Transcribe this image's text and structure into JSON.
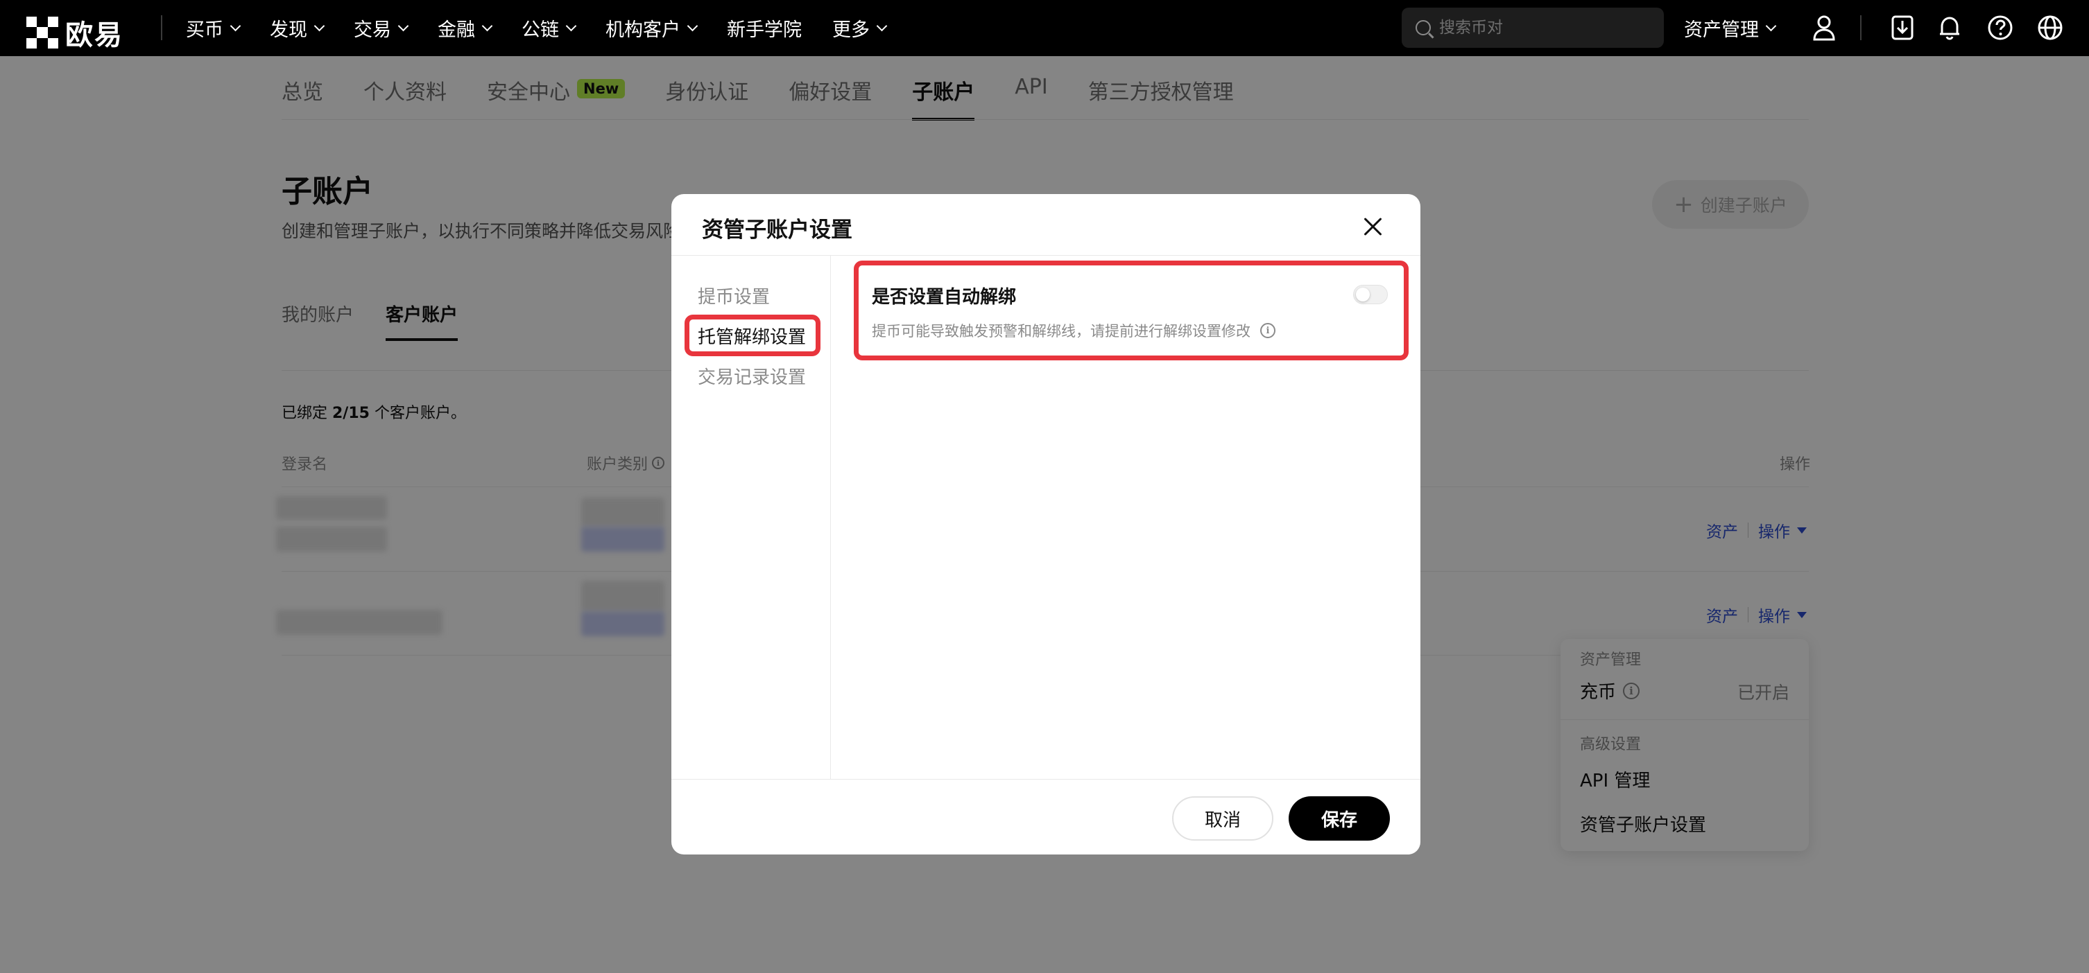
{
  "brand": {
    "name": "欧易"
  },
  "topnav": {
    "items": [
      {
        "label": "买币",
        "dropdown": true
      },
      {
        "label": "发现",
        "dropdown": true
      },
      {
        "label": "交易",
        "dropdown": true
      },
      {
        "label": "金融",
        "dropdown": true
      },
      {
        "label": "公链",
        "dropdown": true
      },
      {
        "label": "机构客户",
        "dropdown": true
      },
      {
        "label": "新手学院",
        "dropdown": false
      },
      {
        "label": "更多",
        "dropdown": true
      }
    ],
    "search_placeholder": "搜索币对",
    "asset_management": "资产管理",
    "icons": [
      "user-icon",
      "download-icon",
      "bell-icon",
      "help-icon",
      "globe-icon"
    ]
  },
  "subnav": {
    "items": [
      {
        "label": "总览"
      },
      {
        "label": "个人资料"
      },
      {
        "label": "安全中心",
        "badge": "New"
      },
      {
        "label": "身份认证"
      },
      {
        "label": "偏好设置"
      },
      {
        "label": "子账户",
        "active": true
      },
      {
        "label": "API"
      },
      {
        "label": "第三方授权管理"
      }
    ]
  },
  "page": {
    "title": "子账户",
    "description": "创建和管理子账户，以执行不同策略并降低交易风险",
    "create_button": "创建子账户",
    "tabs": [
      {
        "label": "我的账户"
      },
      {
        "label": "客户账户",
        "active": true
      }
    ],
    "bound_prefix": "已绑定 ",
    "bound_count": "2/15",
    "bound_suffix": " 个客户账户。",
    "table": {
      "col_login": "登录名",
      "col_type": "账户类别",
      "col_action": "操作",
      "rows": [
        {
          "assets": "资产",
          "action": "操作"
        },
        {
          "assets": "资产",
          "action": "操作"
        }
      ]
    },
    "dropdown": {
      "section_asset": "资产管理",
      "deposit_label": "充币",
      "deposit_status": "已开启",
      "section_advanced": "高级设置",
      "api_label": "API 管理",
      "custody_label": "资管子账户设置"
    }
  },
  "modal": {
    "title": "资管子账户设置",
    "menu": [
      {
        "label": "提币设置"
      },
      {
        "label": "托管解绑设置",
        "active": true
      },
      {
        "label": "交易记录设置"
      }
    ],
    "setting": {
      "title": "是否设置自动解绑",
      "description": "提币可能导致触发预警和解绑线，请提前进行解绑设置修改",
      "enabled": false
    },
    "cancel": "取消",
    "save": "保存"
  },
  "colors": {
    "highlight": "#e8353d",
    "link": "#2d4bd0",
    "new_badge": "#b8f14b"
  }
}
